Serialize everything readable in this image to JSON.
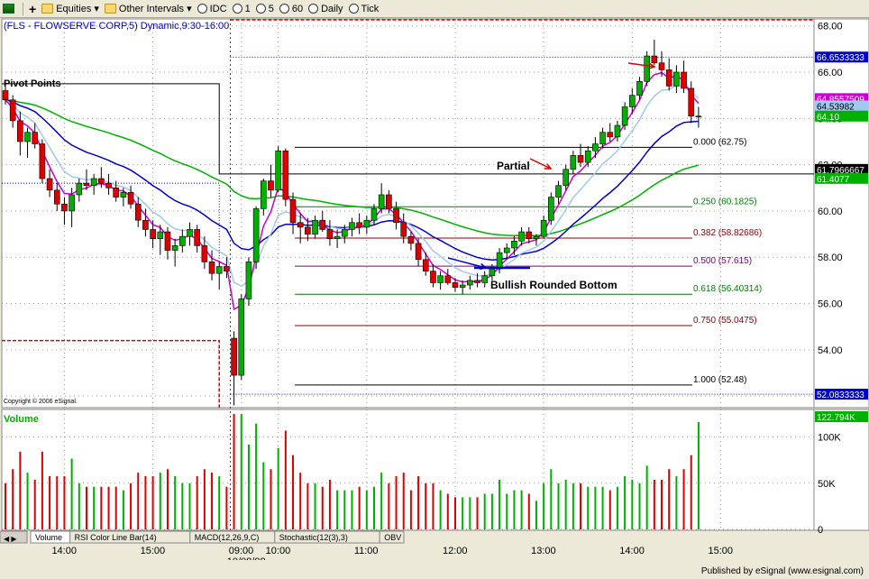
{
  "toolbar": {
    "items": [
      {
        "name": "chart-app-icon",
        "label": ""
      },
      {
        "name": "add-symbol-button",
        "label": "+"
      },
      {
        "name": "equities-menu",
        "label": "Equities ▾"
      },
      {
        "name": "other-intervals-menu",
        "label": "Other Intervals ▾"
      },
      {
        "name": "idc-button",
        "label": "IDC"
      },
      {
        "name": "interval-1-button",
        "label": "1"
      },
      {
        "name": "interval-5-button",
        "label": "5"
      },
      {
        "name": "interval-60-button",
        "label": "60"
      },
      {
        "name": "daily-button",
        "label": "Daily"
      },
      {
        "name": "tick-button",
        "label": "Tick"
      }
    ]
  },
  "chart_data": {
    "type": "candlestick",
    "title": "(FLS - FLOWSERVE CORP,5) Dynamic,9:30-16:00",
    "copyright": "Copyright © 2006 eSignal.",
    "ylim": [
      51.5,
      68.3
    ],
    "price_ticks": [
      "68.00",
      "66.00",
      "64.00",
      "62.00",
      "60.00",
      "58.00",
      "56.00",
      "54.00",
      "52.00"
    ],
    "time_ticks": [
      {
        "label": "14:00",
        "bar": 8
      },
      {
        "label": "15:00",
        "bar": 20
      },
      {
        "label": "09:00",
        "bar": 32
      },
      {
        "label": "10:00",
        "bar": 37
      },
      {
        "label": "11:00",
        "bar": 49
      },
      {
        "label": "12:00",
        "bar": 61
      },
      {
        "label": "13:00",
        "bar": 73
      },
      {
        "label": "14:00",
        "bar": 85
      },
      {
        "label": "15:00",
        "bar": 97
      }
    ],
    "date_label": "10/08/08",
    "prior_session_bars": 31,
    "candles": [
      [
        65.2,
        65.6,
        64.6,
        64.8
      ],
      [
        64.8,
        65.0,
        63.6,
        63.9
      ],
      [
        63.9,
        64.3,
        62.4,
        63.0
      ],
      [
        63.0,
        63.6,
        62.3,
        63.4
      ],
      [
        63.4,
        63.8,
        62.7,
        62.9
      ],
      [
        62.9,
        63.1,
        61.2,
        61.4
      ],
      [
        61.4,
        61.8,
        60.6,
        60.9
      ],
      [
        60.9,
        61.2,
        60.0,
        60.3
      ],
      [
        60.3,
        60.6,
        59.4,
        60.0
      ],
      [
        60.0,
        61.0,
        59.3,
        60.7
      ],
      [
        60.7,
        61.4,
        60.4,
        61.2
      ],
      [
        61.2,
        61.8,
        60.9,
        61.1
      ],
      [
        61.1,
        61.6,
        60.7,
        61.4
      ],
      [
        61.4,
        61.9,
        61.0,
        61.2
      ],
      [
        61.2,
        61.6,
        60.7,
        61.0
      ],
      [
        61.0,
        61.3,
        60.4,
        60.6
      ],
      [
        60.6,
        61.0,
        60.2,
        60.8
      ],
      [
        60.8,
        61.1,
        60.1,
        60.3
      ],
      [
        60.3,
        60.6,
        59.3,
        59.6
      ],
      [
        59.6,
        60.1,
        58.9,
        59.2
      ],
      [
        59.2,
        59.6,
        58.4,
        58.8
      ],
      [
        58.8,
        59.4,
        58.1,
        59.1
      ],
      [
        59.1,
        59.3,
        57.9,
        58.3
      ],
      [
        58.3,
        58.8,
        57.6,
        58.5
      ],
      [
        58.5,
        59.2,
        58.2,
        58.9
      ],
      [
        58.9,
        59.5,
        58.5,
        59.2
      ],
      [
        59.2,
        59.4,
        58.2,
        58.5
      ],
      [
        58.5,
        58.9,
        57.5,
        57.8
      ],
      [
        57.8,
        58.3,
        57.0,
        57.3
      ],
      [
        57.3,
        57.8,
        56.6,
        57.6
      ],
      [
        57.6,
        58.0,
        57.1,
        57.4
      ],
      [
        54.5,
        54.8,
        51.6,
        52.9
      ],
      [
        52.9,
        56.4,
        52.7,
        56.2
      ],
      [
        56.2,
        58.0,
        55.9,
        57.8
      ],
      [
        57.8,
        60.2,
        57.5,
        60.1
      ],
      [
        60.1,
        61.4,
        59.8,
        61.3
      ],
      [
        61.3,
        62.0,
        60.6,
        60.9
      ],
      [
        60.9,
        62.8,
        60.8,
        62.6
      ],
      [
        62.6,
        62.7,
        60.2,
        60.5
      ],
      [
        60.5,
        60.8,
        59.0,
        59.5
      ],
      [
        59.5,
        59.9,
        58.6,
        59.3
      ],
      [
        59.3,
        59.7,
        58.7,
        59.0
      ],
      [
        59.0,
        59.8,
        58.8,
        59.6
      ],
      [
        59.6,
        60.0,
        59.1,
        59.2
      ],
      [
        59.2,
        59.6,
        58.5,
        58.8
      ],
      [
        58.8,
        59.2,
        58.4,
        58.9
      ],
      [
        58.9,
        59.4,
        58.6,
        59.2
      ],
      [
        59.2,
        59.7,
        58.9,
        59.5
      ],
      [
        59.5,
        59.9,
        59.0,
        59.3
      ],
      [
        59.3,
        59.8,
        59.0,
        59.6
      ],
      [
        59.6,
        60.3,
        59.4,
        60.1
      ],
      [
        60.1,
        61.2,
        59.9,
        60.7
      ],
      [
        60.7,
        60.9,
        59.9,
        60.1
      ],
      [
        60.1,
        60.4,
        59.2,
        59.5
      ],
      [
        59.5,
        59.9,
        58.6,
        58.9
      ],
      [
        58.9,
        59.1,
        58.3,
        58.6
      ],
      [
        58.6,
        58.8,
        57.6,
        57.9
      ],
      [
        57.9,
        58.2,
        57.2,
        57.4
      ],
      [
        57.4,
        57.7,
        56.7,
        56.9
      ],
      [
        56.9,
        57.4,
        56.6,
        57.2
      ],
      [
        57.2,
        57.5,
        56.8,
        56.9
      ],
      [
        56.9,
        57.1,
        56.5,
        56.7
      ],
      [
        56.7,
        57.0,
        56.4,
        56.8
      ],
      [
        56.8,
        57.2,
        56.6,
        57.0
      ],
      [
        57.0,
        57.3,
        56.7,
        56.9
      ],
      [
        56.9,
        57.4,
        56.7,
        57.2
      ],
      [
        57.2,
        57.7,
        57.0,
        57.5
      ],
      [
        57.5,
        58.4,
        57.3,
        58.2
      ],
      [
        58.2,
        58.6,
        57.9,
        58.4
      ],
      [
        58.4,
        58.9,
        58.1,
        58.7
      ],
      [
        58.7,
        59.3,
        58.5,
        59.1
      ],
      [
        59.1,
        59.3,
        58.6,
        58.8
      ],
      [
        58.8,
        59.0,
        58.5,
        58.9
      ],
      [
        58.9,
        59.8,
        58.8,
        59.6
      ],
      [
        59.6,
        60.8,
        59.4,
        60.6
      ],
      [
        60.6,
        61.3,
        60.3,
        61.1
      ],
      [
        61.1,
        62.0,
        60.9,
        61.8
      ],
      [
        61.8,
        62.6,
        61.6,
        62.4
      ],
      [
        62.4,
        62.9,
        61.9,
        62.1
      ],
      [
        62.1,
        62.8,
        61.9,
        62.6
      ],
      [
        62.6,
        63.2,
        62.3,
        62.9
      ],
      [
        62.9,
        63.6,
        62.7,
        63.4
      ],
      [
        63.4,
        63.8,
        63.0,
        63.2
      ],
      [
        63.2,
        63.9,
        63.0,
        63.7
      ],
      [
        63.7,
        64.7,
        63.5,
        64.5
      ],
      [
        64.5,
        65.3,
        64.2,
        65.0
      ],
      [
        65.0,
        65.8,
        64.8,
        65.6
      ],
      [
        65.6,
        66.9,
        65.4,
        66.7
      ],
      [
        66.7,
        67.4,
        66.3,
        66.4
      ],
      [
        66.4,
        66.9,
        65.8,
        66.1
      ],
      [
        66.1,
        66.6,
        65.2,
        65.4
      ],
      [
        65.4,
        66.3,
        65.1,
        66.0
      ],
      [
        66.0,
        66.5,
        65.1,
        65.3
      ],
      [
        65.3,
        65.6,
        63.8,
        64.1
      ],
      [
        64.1,
        64.5,
        63.6,
        64.1
      ]
    ],
    "fib_levels": [
      {
        "label": "0.000 (62.75)",
        "price": 62.75,
        "color": "#000000"
      },
      {
        "label": "0.250 (60.1825)",
        "price": 60.1825,
        "color": "#008000"
      },
      {
        "label": "0.382 (58.82686)",
        "price": 58.82686,
        "color": "#8b0000"
      },
      {
        "label": "0.500 (57.615)",
        "price": 57.615,
        "color": "#800080"
      },
      {
        "label": "0.618 (56.40314)",
        "price": 56.40314,
        "color": "#008000"
      },
      {
        "label": "0.750 (55.0475)",
        "price": 55.0475,
        "color": "#8b0000"
      },
      {
        "label": "1.000 (52.48)",
        "price": 52.48,
        "color": "#000000"
      }
    ],
    "annotations": {
      "pivot": "Pivot Points",
      "partial": "Partial",
      "rounded_bottom": "Bullish Rounded Bottom"
    },
    "price_tags": [
      {
        "label": "66.6533333",
        "price": 66.6533333,
        "bg": "#0000cc",
        "fg": "#ffffff"
      },
      {
        "label": "64.8557509",
        "price": 64.8557509,
        "bg": "#cc00cc",
        "fg": "#ffffff"
      },
      {
        "label": "64.53982",
        "price": 64.53982,
        "bg": "#a0c8f0",
        "fg": "#000000"
      },
      {
        "label": "64.10",
        "price": 64.1,
        "bg": "#00b000",
        "fg": "#ffffff"
      },
      {
        "label": "61.7966667",
        "price": 61.7966667,
        "bg": "#000000",
        "fg": "#ffffff"
      },
      {
        "label": "61.4077",
        "price": 61.4077,
        "bg": "#00b000",
        "fg": "#ffffff"
      },
      {
        "label": "52.0833333",
        "price": 52.0833333,
        "bg": "#0000cc",
        "fg": "#ffffff"
      }
    ],
    "volume": {
      "title": "Volume",
      "last_label": "122.794K",
      "ticks": [
        {
          "label": "100K",
          "value": 100
        },
        {
          "label": "50K",
          "value": 50
        },
        {
          "label": "0",
          "value": 0
        }
      ],
      "ylim": [
        0,
        125
      ]
    },
    "tabs": [
      "Volume",
      "RSI Color Line Bar(14)",
      "MACD(12,26,9,C)",
      "Stochastic(12(3),3)",
      "OBV"
    ],
    "colors": {
      "up": "#00b000",
      "down": "#dd0000",
      "ema_fast": "#cc00cc",
      "ema_mid": "#a0c8f0",
      "ema_slow": "#0000cc",
      "ema_long": "#00b000"
    }
  },
  "footer": "Published by eSignal (www.esignal.com)"
}
